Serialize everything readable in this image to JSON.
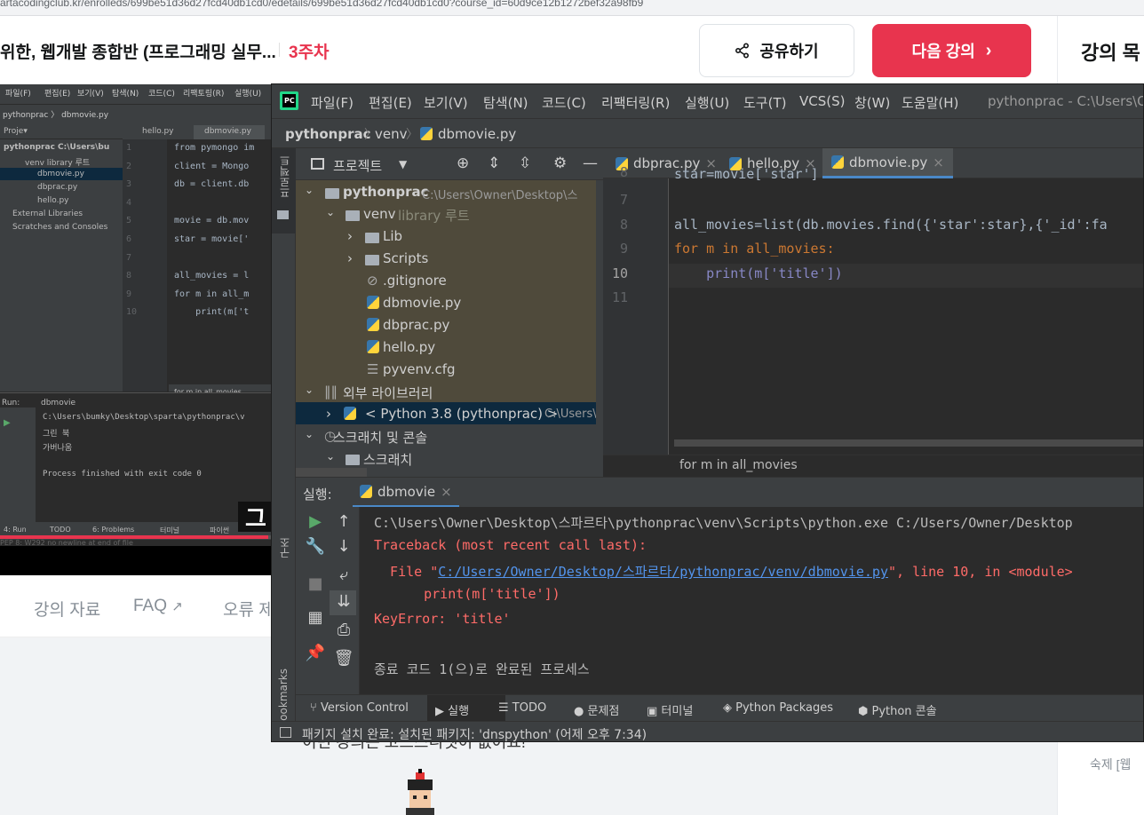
{
  "browser": {
    "url": "artacodingclub.kr/enrolleds/699be51d36d27fcd40db1cd0/edetails/699be51d36d27fcd40db1cd0?course_id=60d9ce12b1272bef32a98fb9"
  },
  "course": {
    "title": "위한, 웹개발 종합반 (프로그래밍 실무...",
    "week": "3주차",
    "share_label": "공유하기",
    "next_label": "다음 강의",
    "toc_title": "강의 목",
    "toc_sub": "숙제 [웹",
    "tabs": [
      "강의 자료",
      "FAQ",
      "오류 제"
    ],
    "note_text": "이번 강의는 코드스니펫이 없어요!"
  },
  "video": {
    "menu": [
      "파일(F)",
      "편집(E)",
      "보기(V)",
      "탐색(N)",
      "코드(C)",
      "리팩토링(R)",
      "실행(U)"
    ],
    "project_tabs": [
      "Proje▾",
      "hello.py",
      "dbmovie.py"
    ],
    "tree": [
      "pythonprac  C:\\Users\\bu",
      "venv  library 루트",
      "dbmovie.py",
      "dbprac.py",
      "hello.py",
      "External Libraries",
      "Scratches and Consoles"
    ],
    "code_lines": [
      "from pymongo im",
      "client = Mongo",
      "db = client.db",
      "",
      "movie = db.mov",
      "star = movie['",
      "",
      "all_movies = l",
      "for m in all_m",
      "    print(m['t"
    ],
    "line_numbers": [
      "1",
      "2",
      "3",
      "4",
      "5",
      "6",
      "7",
      "8",
      "9",
      "10"
    ],
    "crumb": "for m in all_movies",
    "run_label": "Run:",
    "run_tab": "dbmovie",
    "run_output": [
      "C:\\Users\\bumky\\Desktop\\sparta\\pythonprac\\v",
      "그린 북",
      "가버나움",
      "",
      "Process finished with exit code 0"
    ],
    "bottom_tabs": [
      "4: Run",
      "TODO",
      "6: Problems",
      "터미널",
      "파이썬"
    ],
    "status": "PEP 8: W292 no newline at end of file",
    "subtitle": "그",
    "progress": 0.99
  },
  "ide": {
    "menu": [
      "파일(F)",
      "편집(E)",
      "보기(V)",
      "탐색(N)",
      "코드(C)",
      "리팩터링(R)",
      "실행(U)",
      "도구(T)",
      "VCS(S)",
      "창(W)",
      "도움말(H)"
    ],
    "window_title": "pythonprac - C:\\Users\\Ow",
    "breadcrumb": [
      "pythonprac",
      "venv",
      "dbmovie.py"
    ],
    "project_title": "프로젝트",
    "left_strip_label": "프로젝트",
    "structure_label": "구조",
    "bookmarks_label": "Bookmarks",
    "tree": [
      {
        "label": "pythonprac",
        "hint": "C:\\Users\\Owner\\Desktop\\스"
      },
      {
        "label": "venv",
        "hint": "library 루트"
      },
      {
        "label": "Lib",
        "hint": ""
      },
      {
        "label": "Scripts",
        "hint": ""
      },
      {
        "label": ".gitignore",
        "hint": ""
      },
      {
        "label": "dbmovie.py",
        "hint": ""
      },
      {
        "label": "dbprac.py",
        "hint": ""
      },
      {
        "label": "hello.py",
        "hint": ""
      },
      {
        "label": "pyvenv.cfg",
        "hint": ""
      },
      {
        "label": "외부 라이브러리",
        "hint": ""
      },
      {
        "label": "< Python 3.8 (pythonprac) >",
        "hint": "C:\\Users\\"
      },
      {
        "label": "스크래치 및 콘솔",
        "hint": ""
      },
      {
        "label": "스크래치",
        "hint": ""
      }
    ],
    "tabs": [
      "dbprac.py",
      "hello.py",
      "dbmovie.py"
    ],
    "code": {
      "partial_top": "star=movie['star']",
      "line_numbers": [
        "7",
        "8",
        "9",
        "10",
        "11"
      ],
      "line8": "all_movies=list(db.movies.find({'star':star},{'_id':fa",
      "line9": "for m in all_movies:",
      "line10": "    print(m['title'])"
    },
    "editor_crumb": "for m in all_movies",
    "run_label": "실행:",
    "run_tab": "dbmovie",
    "console": {
      "cmd": "C:\\Users\\Owner\\Desktop\\스파르타\\pythonprac\\venv\\Scripts\\python.exe C:/Users/Owner/Desktop",
      "traceback": "Traceback (most recent call last):",
      "file_prefix": "  File \"",
      "file_link": "C:/Users/Owner/Desktop/스파르타/pythonprac/venv/dbmovie.py",
      "file_suffix": "\", line 10, in <module>",
      "code_line": "    print(m['title'])",
      "error": "KeyError: 'title'",
      "exit": "종료 코드 1(으)로 완료된 프로세스"
    },
    "bottom_tools": [
      "Version Control",
      "실행",
      "TODO",
      "문제점",
      "터미널",
      "Python Packages",
      "Python 콘솔"
    ],
    "status": "패키지 설치 완료: 설치된 패키지: 'dnspython' (어제 오후 7:34)"
  },
  "colors": {
    "accent": "#e8344e",
    "ide_bg": "#2b2b2b",
    "ide_panel": "#3c3f41",
    "error": "#ff6b68",
    "keyword": "#cc7832",
    "string": "#6a8759"
  }
}
